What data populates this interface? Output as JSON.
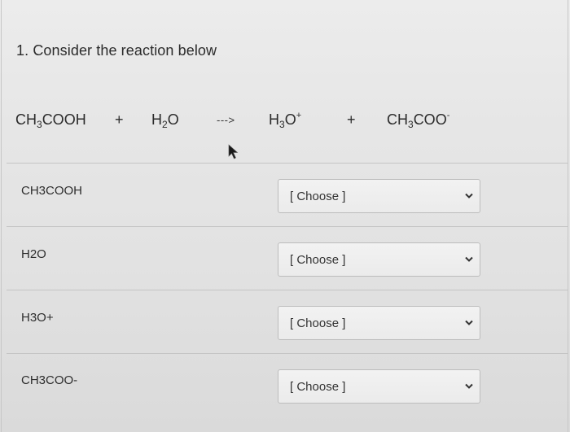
{
  "question": {
    "title": "1. Consider the reaction below"
  },
  "equation": {
    "reactant1": {
      "a": "CH",
      "sub1": "3",
      "b": "COOH"
    },
    "plus1": "+",
    "reactant2": {
      "a": "H",
      "sub1": "2",
      "b": "O"
    },
    "arrow": "--->",
    "product1": {
      "a": "H",
      "sub1": "3",
      "b": "O",
      "sup": "+"
    },
    "plus2": "+",
    "product2": {
      "a": "CH",
      "sub1": "3",
      "b": "COO",
      "sup": "-"
    }
  },
  "rows": [
    {
      "label": "CH3COOH",
      "select": "[ Choose ]"
    },
    {
      "label": "H2O",
      "select": "[ Choose ]"
    },
    {
      "label": "H3O+",
      "select": "[ Choose ]"
    },
    {
      "label": "CH3COO-",
      "select": "[ Choose ]"
    }
  ],
  "icons": {
    "cursor": "mouse-pointer-icon",
    "dropdown": "chevron-down-icon"
  },
  "colors": {
    "text": "#2b2b2b",
    "divider": "#c5c5c5",
    "select_border": "#bcbcbc"
  }
}
